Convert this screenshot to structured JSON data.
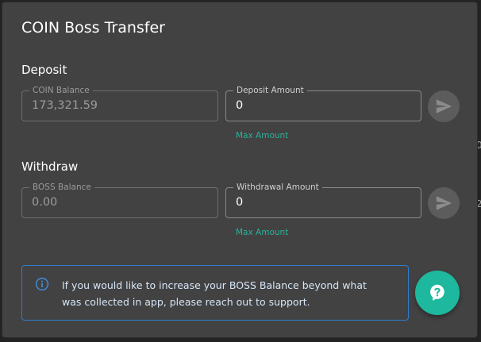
{
  "modal": {
    "title": "COIN Boss Transfer"
  },
  "deposit": {
    "section_title": "Deposit",
    "balance_label": "COIN Balance",
    "balance_value": "173,321.59",
    "amount_label": "Deposit Amount",
    "amount_value": "0",
    "max_link": "Max Amount",
    "send_icon": "send-icon"
  },
  "withdraw": {
    "section_title": "Withdraw",
    "balance_label": "BOSS Balance",
    "balance_value": "0.00",
    "amount_label": "Withdrawal Amount",
    "amount_value": "0",
    "max_link": "Max Amount",
    "send_icon": "send-icon"
  },
  "info": {
    "icon": "info-icon",
    "message": "If you would like to increase your BOSS Balance beyond what was collected in app, please reach out to support."
  },
  "help_button": {
    "icon": "help-chat-icon"
  },
  "colors": {
    "modal_bg": "#424242",
    "accent_teal": "#1db89d",
    "link_teal": "#26b39b",
    "info_blue": "#2f7ccd"
  }
}
